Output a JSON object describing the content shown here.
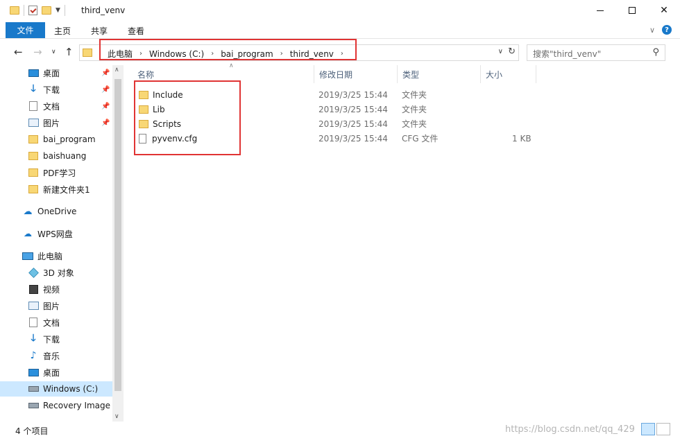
{
  "window": {
    "title": "third_venv",
    "controls": {
      "minimize": "",
      "maximize": "",
      "close": "✕"
    }
  },
  "ribbon": {
    "file": "文件",
    "tabs": [
      "主页",
      "共享",
      "查看"
    ]
  },
  "address": {
    "crumbs": [
      "此电脑",
      "Windows (C:)",
      "bai_program",
      "third_venv"
    ],
    "search_placeholder": "搜索\"third_venv\""
  },
  "sidebar": {
    "quick_access": [
      {
        "label": "桌面",
        "icon": "desktop-icon",
        "pinned": true
      },
      {
        "label": "下载",
        "icon": "download-icon",
        "pinned": true
      },
      {
        "label": "文档",
        "icon": "document-icon",
        "pinned": true
      },
      {
        "label": "图片",
        "icon": "picture-icon",
        "pinned": true
      },
      {
        "label": "bai_program",
        "icon": "folder-icon",
        "pinned": false
      },
      {
        "label": "baishuang",
        "icon": "folder-icon",
        "pinned": false
      },
      {
        "label": "PDF学习",
        "icon": "folder-icon",
        "pinned": false
      },
      {
        "label": "新建文件夹1",
        "icon": "folder-icon",
        "pinned": false
      }
    ],
    "onedrive": "OneDrive",
    "wps": "WPS网盘",
    "this_pc": "此电脑",
    "pc_items": [
      {
        "label": "3D 对象",
        "icon": "3d-objects-icon"
      },
      {
        "label": "视频",
        "icon": "video-icon"
      },
      {
        "label": "图片",
        "icon": "picture-icon"
      },
      {
        "label": "文档",
        "icon": "document-icon"
      },
      {
        "label": "下载",
        "icon": "download-icon"
      },
      {
        "label": "音乐",
        "icon": "music-icon"
      },
      {
        "label": "桌面",
        "icon": "desktop-icon"
      },
      {
        "label": "Windows (C:)",
        "icon": "drive-icon",
        "selected": true
      },
      {
        "label": "Recovery Image",
        "icon": "drive-icon"
      }
    ]
  },
  "columns": {
    "name": "名称",
    "modified": "修改日期",
    "type": "类型",
    "size": "大小"
  },
  "files": [
    {
      "name": "Include",
      "modified": "2019/3/25 15:44",
      "type": "文件夹",
      "size": "",
      "icon": "folder-icon"
    },
    {
      "name": "Lib",
      "modified": "2019/3/25 15:44",
      "type": "文件夹",
      "size": "",
      "icon": "folder-icon"
    },
    {
      "name": "Scripts",
      "modified": "2019/3/25 15:44",
      "type": "文件夹",
      "size": "",
      "icon": "folder-icon"
    },
    {
      "name": "pyvenv.cfg",
      "modified": "2019/3/25 15:44",
      "type": "CFG 文件",
      "size": "1 KB",
      "icon": "cfg-file-icon"
    }
  ],
  "status": {
    "count": "4 个项目",
    "watermark": "https://blog.csdn.net/qq_429"
  },
  "colors": {
    "accent": "#1979ca",
    "selection": "#cce8ff",
    "highlight": "#e03333"
  }
}
